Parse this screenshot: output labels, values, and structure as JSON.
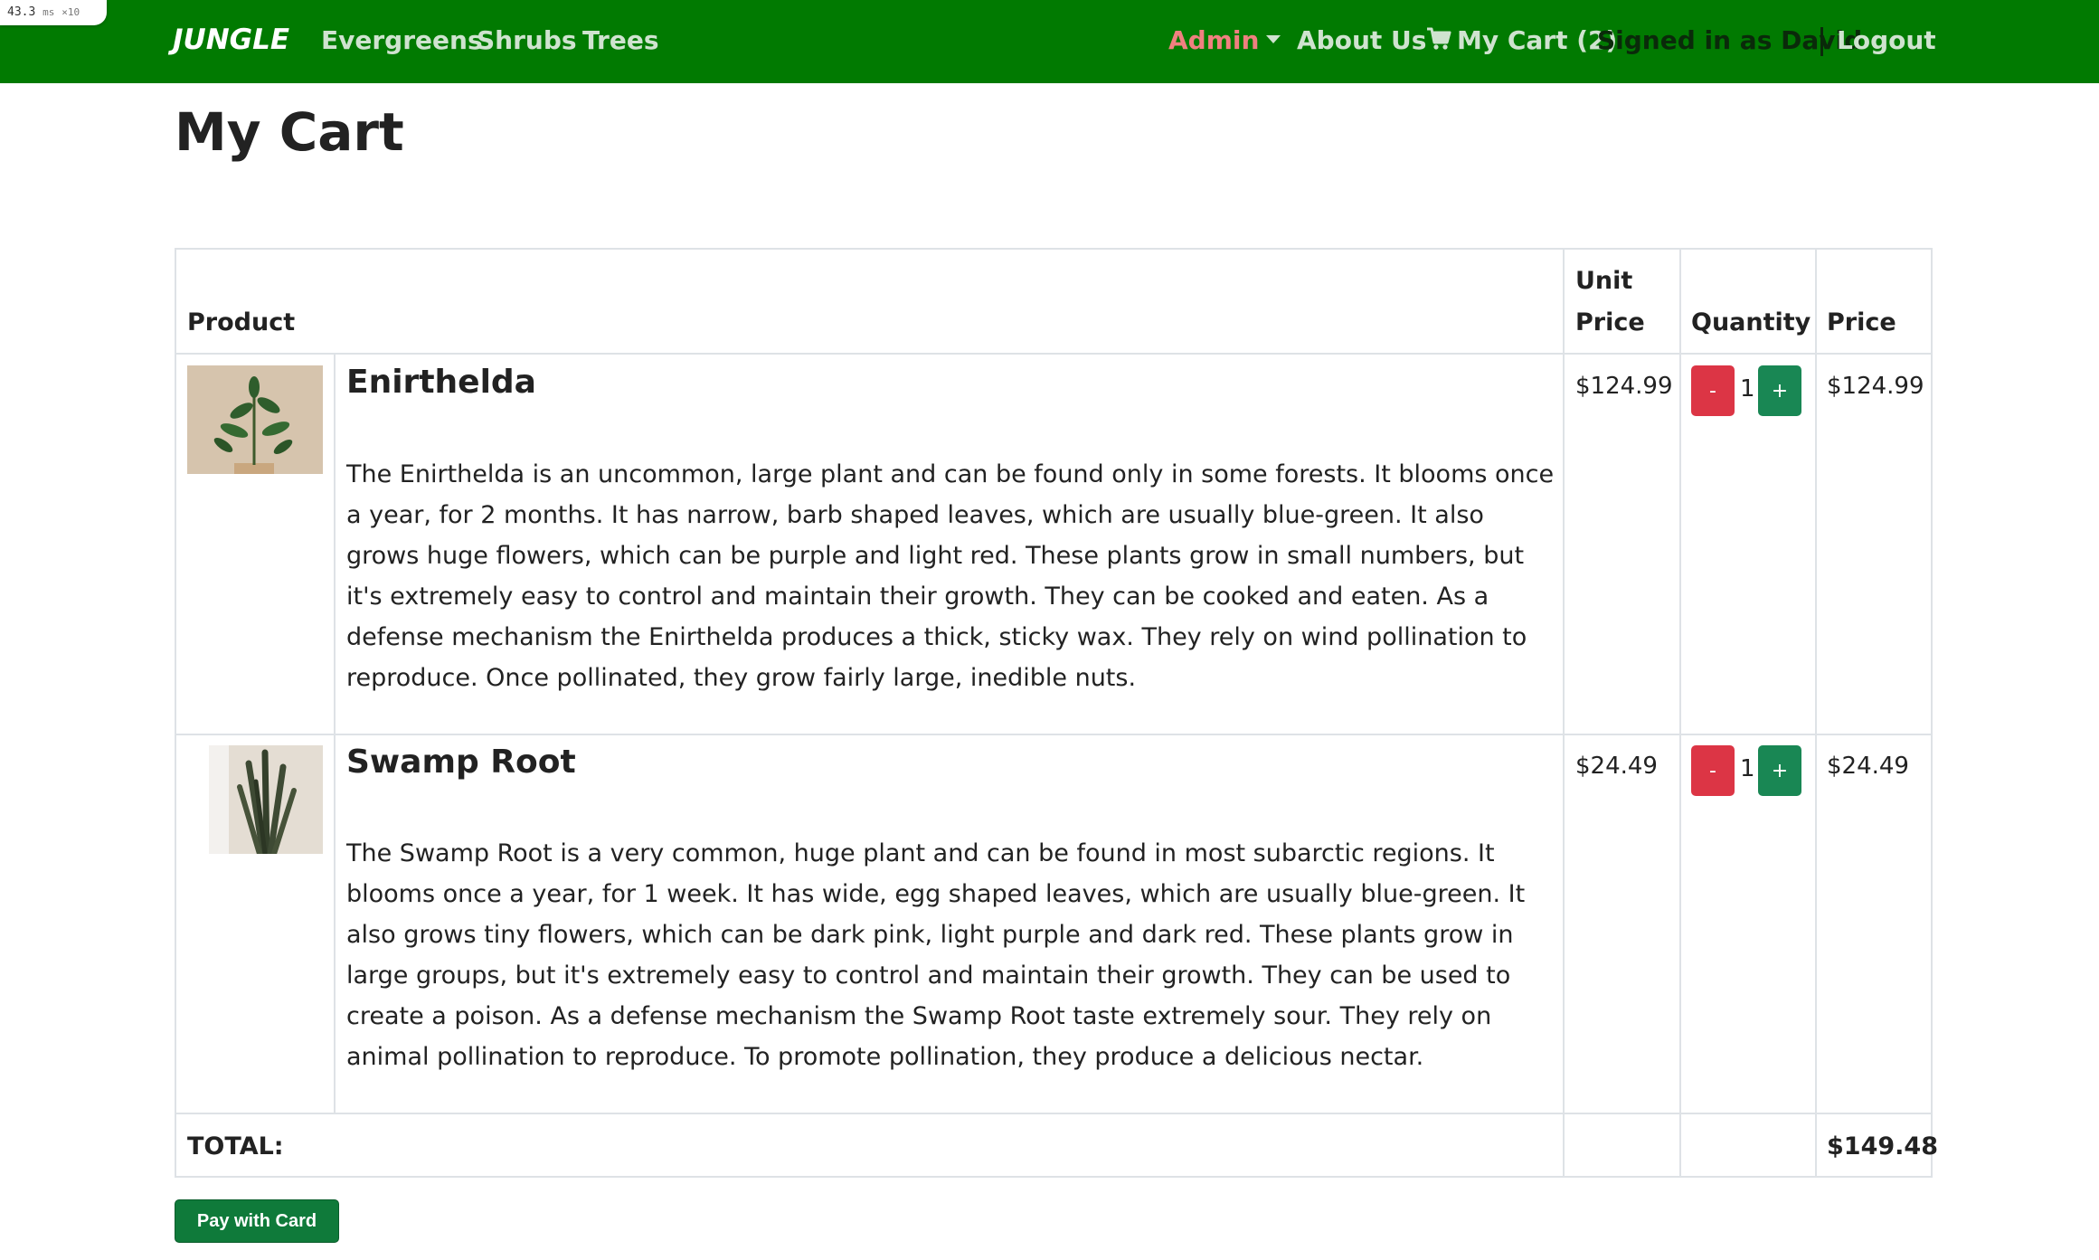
{
  "perf": {
    "value": "43.3",
    "unit": "ms",
    "multiplier": "×10"
  },
  "nav": {
    "brand": "JUNGLE",
    "links": [
      "Evergreens",
      "Shrubs",
      "Trees"
    ],
    "admin": "Admin",
    "about": "About Us",
    "cart": "My Cart (2)",
    "signed_in": "Signed in as David",
    "logout": "Logout"
  },
  "page": {
    "title": "My Cart"
  },
  "table": {
    "headers": {
      "product": "Product",
      "unit_price_1": "Unit",
      "unit_price_2": "Price",
      "quantity": "Quantity",
      "price": "Price"
    },
    "items": [
      {
        "name": "Enirthelda",
        "description": "The Enirthelda is an uncommon, large plant and can be found only in some forests. It blooms once a year, for 2 months. It has narrow, barb shaped leaves, which are usually blue-green. It also grows huge flowers, which can be purple and light red. These plants grow in small numbers, but it's extremely easy to control and maintain their growth. They can be cooked and eaten. As a defense mechanism the Enirthelda produces a thick, sticky wax. They rely on wind pollination to reproduce. Once pollinated, they grow fairly large, inedible nuts.",
        "unit_price": "$124.99",
        "quantity": "1",
        "price": "$124.99",
        "minus": "-",
        "plus": "+"
      },
      {
        "name": "Swamp Root",
        "description": "The Swamp Root is a very common, huge plant and can be found in most subarctic regions. It blooms once a year, for 1 week. It has wide, egg shaped leaves, which are usually blue-green. It also grows tiny flowers, which can be dark pink, light purple and dark red. These plants grow in large groups, but it's extremely easy to control and maintain their growth. They can be used to create a poison. As a defense mechanism the Swamp Root taste extremely sour. They rely on animal pollination to reproduce. To promote pollination, they produce a delicious nectar.",
        "unit_price": "$24.49",
        "quantity": "1",
        "price": "$24.49",
        "minus": "-",
        "plus": "+"
      }
    ],
    "total_label": "TOTAL:",
    "total_value": "$149.48"
  },
  "pay_button": "Pay with Card",
  "colors": {
    "navbar": "#017a01",
    "minus_button": "#dc3545",
    "plus_button": "#198754",
    "pay_button": "#0f7a3a",
    "admin_link": "#f08080"
  }
}
